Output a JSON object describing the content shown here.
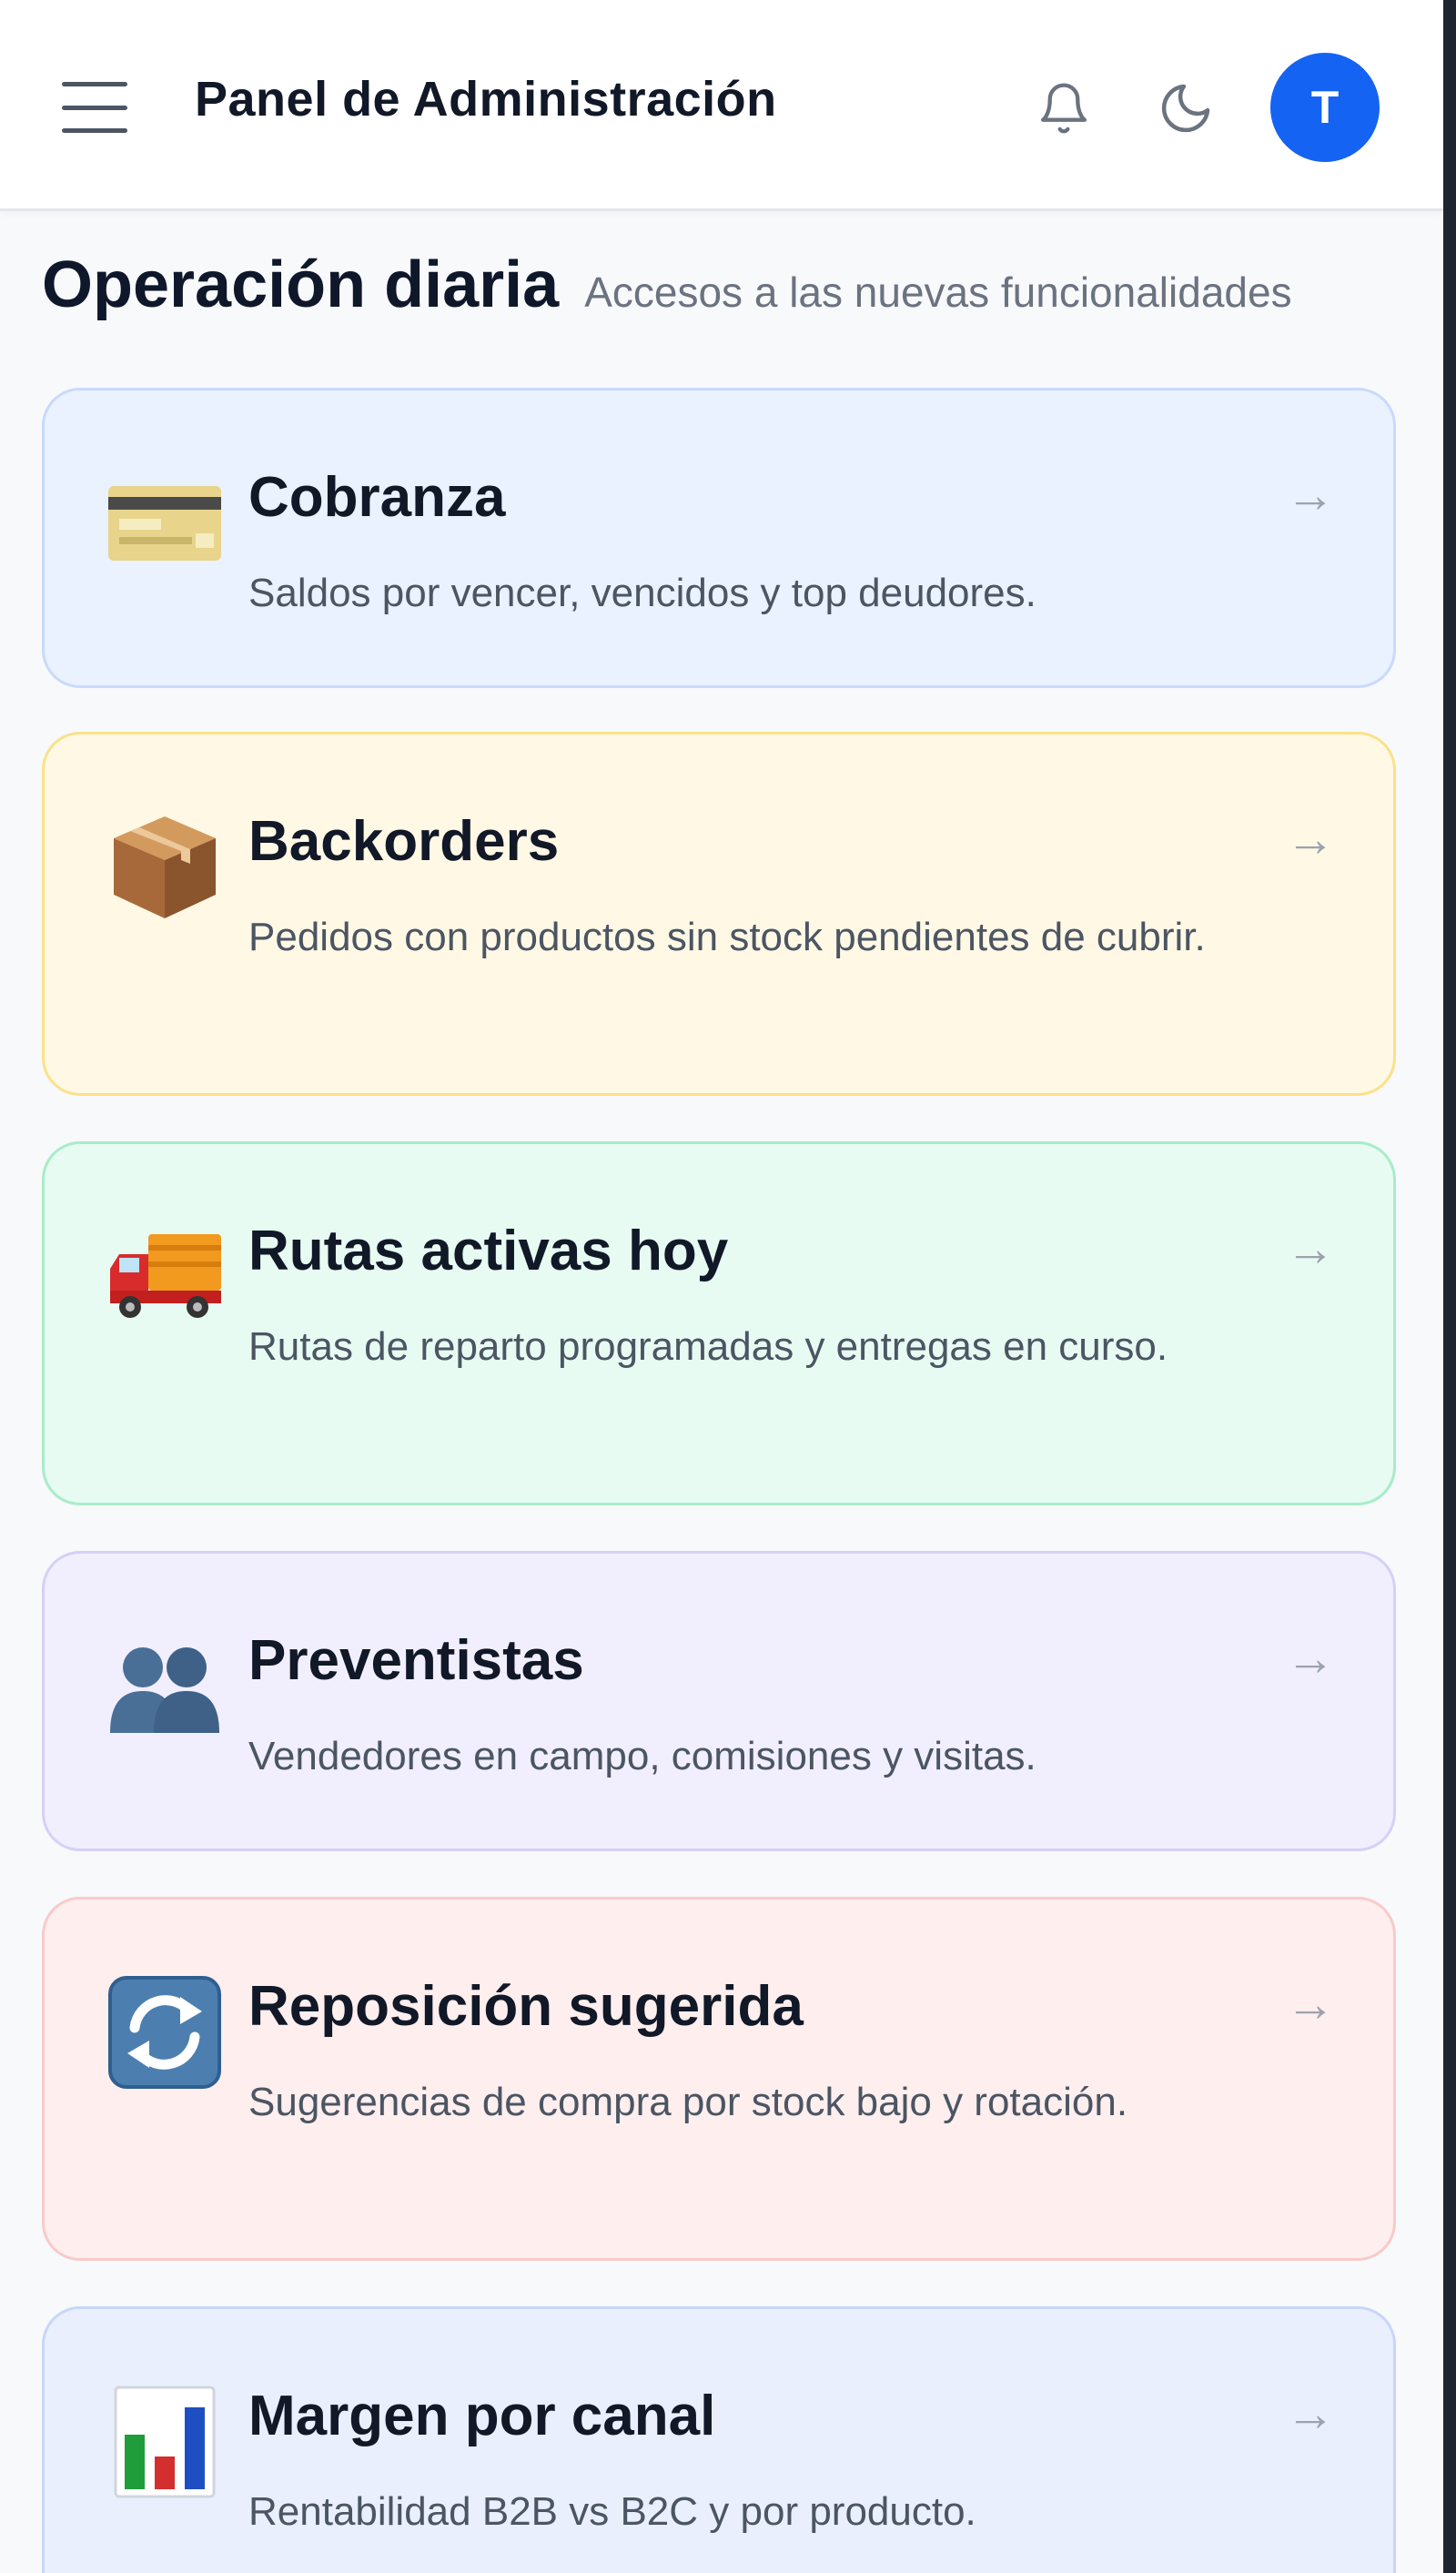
{
  "header": {
    "title": "Panel de Administración",
    "avatar_initial": "T",
    "icons": [
      "menu-icon",
      "bell-icon",
      "moon-icon"
    ]
  },
  "section": {
    "title": "Operación diaria",
    "subtitle": "Accesos a las nuevas funcionalidades"
  },
  "cards": [
    {
      "title": "Cobranza",
      "description": "Saldos por vencer, vencidos y top deudores.",
      "icon": "credit-card-icon",
      "arrow": "→",
      "color": "#eaf1ff"
    },
    {
      "title": "Backorders",
      "description": "Pedidos con productos sin stock pendientes de cubrir.",
      "icon": "package-icon",
      "arrow": "→",
      "color": "#fff8e5"
    },
    {
      "title": "Rutas activas hoy",
      "description": "Rutas de reparto programadas y entregas en curso.",
      "icon": "delivery-truck-icon",
      "arrow": "→",
      "color": "#e7fbf2"
    },
    {
      "title": "Preventistas",
      "description": "Vendedores en campo, comisiones y visitas.",
      "icon": "people-icon",
      "arrow": "→",
      "color": "#f1effd"
    },
    {
      "title": "Reposición sugerida",
      "description": "Sugerencias de compra por stock bajo y rotación.",
      "icon": "refresh-icon",
      "arrow": "→",
      "color": "#feeeee"
    },
    {
      "title": "Margen por canal",
      "description": "Rentabilidad B2B vs B2C y por producto.",
      "icon": "bar-chart-icon",
      "arrow": "→",
      "color": "#e9effd"
    }
  ],
  "colors": {
    "accent": "#1463f3",
    "background": "#f8f9fb"
  }
}
